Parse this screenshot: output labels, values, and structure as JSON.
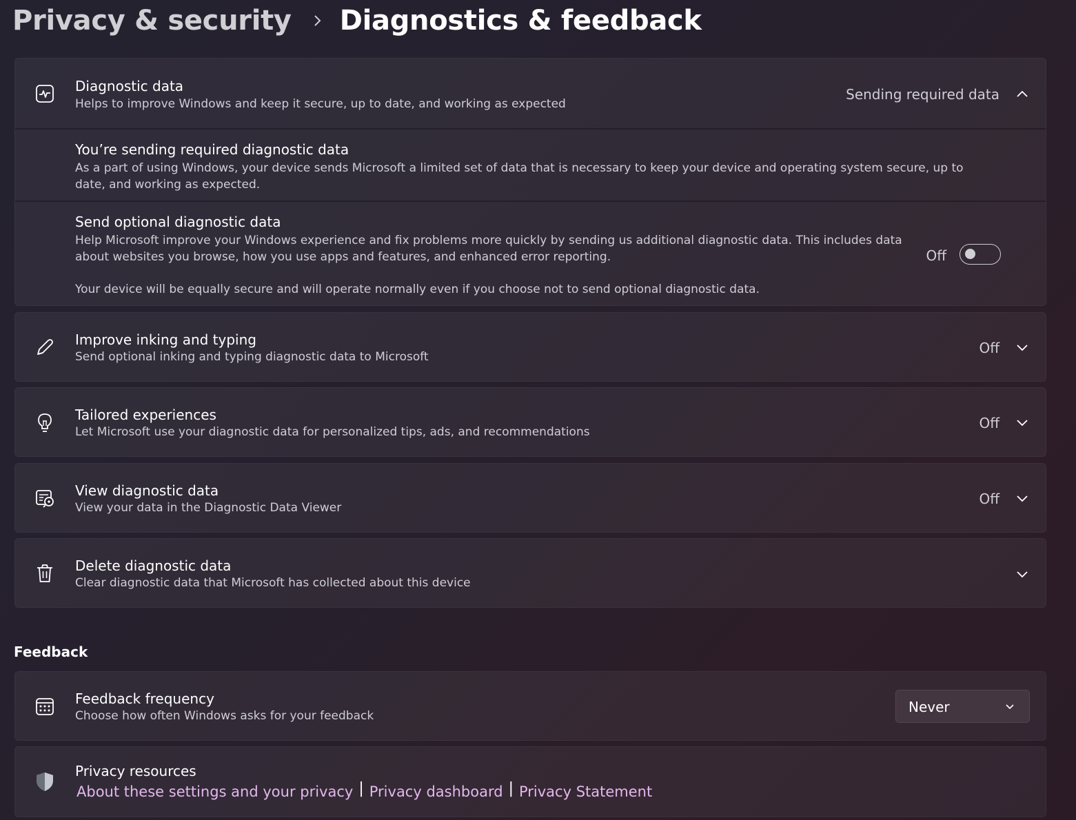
{
  "breadcrumb": {
    "parent": "Privacy & security",
    "separator_icon": "chevron-right-icon",
    "current": "Diagnostics & feedback"
  },
  "diagnostic_data": {
    "icon": "pulse-icon",
    "title": "Diagnostic data",
    "description": "Helps to improve Windows and keep it secure, up to date, and working as expected",
    "status": "Sending required data",
    "expanded": true,
    "required": {
      "title": "You’re sending required diagnostic data",
      "description": "As a part of using Windows, your device sends Microsoft a limited set of data that is necessary to keep your device and operating system secure, up to date, and working as expected."
    },
    "optional": {
      "title": "Send optional diagnostic data",
      "description": "Help Microsoft improve your Windows experience and fix problems more quickly by sending us additional diagnostic data. This includes data about websites you browse, how you use apps and features, and enhanced error reporting.",
      "note": "Your device will be equally secure and will operate normally even if you choose not to send optional diagnostic data.",
      "toggle_label": "Off",
      "toggle_on": false
    }
  },
  "inking": {
    "icon": "pen-icon",
    "title": "Improve inking and typing",
    "description": "Send optional inking and typing diagnostic data to Microsoft",
    "status": "Off"
  },
  "tailored": {
    "icon": "lightbulb-icon",
    "title": "Tailored experiences",
    "description": "Let Microsoft use your diagnostic data for personalized tips, ads, and recommendations",
    "status": "Off"
  },
  "view_data": {
    "icon": "data-viewer-icon",
    "title": "View diagnostic data",
    "description": "View your data in the Diagnostic Data Viewer",
    "status": "Off"
  },
  "delete_data": {
    "icon": "trash-icon",
    "title": "Delete diagnostic data",
    "description": "Clear diagnostic data that Microsoft has collected about this device"
  },
  "feedback": {
    "heading": "Feedback",
    "frequency": {
      "icon": "calendar-icon",
      "title": "Feedback frequency",
      "description": "Choose how often Windows asks for your feedback",
      "selected": "Never"
    }
  },
  "privacy_resources": {
    "icon": "shield-icon",
    "title": "Privacy resources",
    "links": [
      "About these settings and your privacy",
      "Privacy dashboard",
      "Privacy Statement"
    ],
    "separator": "|"
  },
  "colors": {
    "link": "#e4b7ee",
    "card": "rgba(255,255,255,0.05)"
  }
}
